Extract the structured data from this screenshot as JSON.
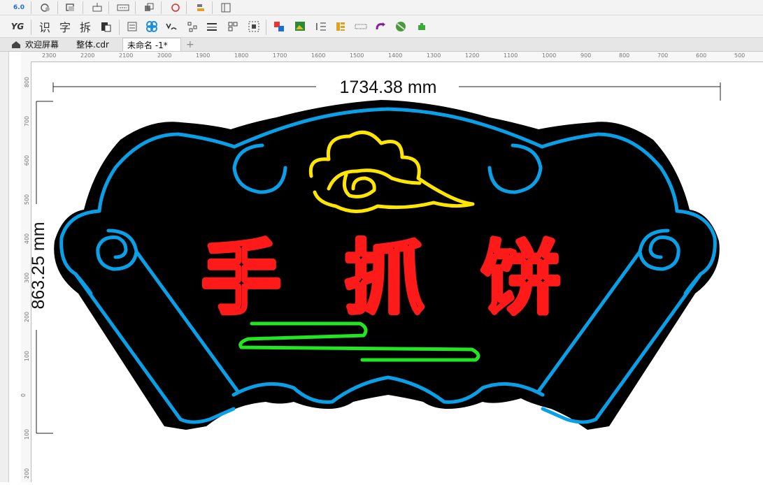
{
  "toolbar_top": {
    "version_badge": "6.0",
    "icons": [
      "convert-icon",
      "group-icon",
      "import-icon",
      "dash-icon",
      "arrange-icon",
      "weld-icon",
      "align-icon",
      "page-icon"
    ]
  },
  "toolbar_second": {
    "yg_label": "YG",
    "text_buttons": [
      "识",
      "字",
      "拆"
    ],
    "icons": [
      "paste-icon",
      "list-icon",
      "shape-icon",
      "curve-icon",
      "nodes-icon",
      "stroke-icon",
      "grid-icon",
      "select-icon",
      "color-icon",
      "image-icon",
      "text-align-icon",
      "layers-icon",
      "dots-icon",
      "transform-icon",
      "globe-icon",
      "plugin-icon"
    ]
  },
  "tabs": [
    {
      "label": "欢迎屏幕"
    },
    {
      "label": "整体.cdr"
    },
    {
      "label": "未命名 -1*"
    }
  ],
  "ruler": {
    "h_ticks": [
      "2300",
      "2200",
      "2100",
      "2000",
      "1900",
      "1800",
      "1700",
      "1600",
      "1500",
      "1400",
      "1300",
      "1200",
      "1100",
      "1000",
      "900",
      "800",
      "700",
      "600",
      "500"
    ],
    "v_ticks": [
      "800",
      "700",
      "600",
      "500",
      "400",
      "300",
      "200",
      "100",
      "0",
      "100",
      "200"
    ]
  },
  "drawing": {
    "width_dimension": "1734.38 mm",
    "height_dimension": "863.25 mm",
    "title_chars": [
      "手",
      "抓",
      "饼"
    ],
    "colors": {
      "board": "#000000",
      "outline": "#0aa0e8",
      "title": "#ff1a1a",
      "cloud": "#ffee00",
      "wind": "#22e622",
      "dimension": "#111111"
    }
  }
}
